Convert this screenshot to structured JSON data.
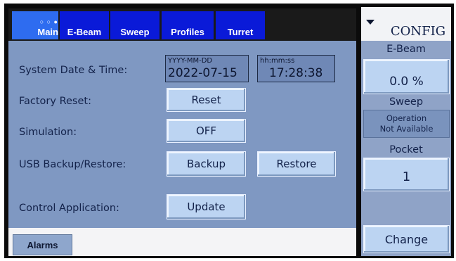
{
  "tabs": [
    {
      "label": "Main",
      "active": true,
      "dots": "○ ○ ●"
    },
    {
      "label": "E-Beam"
    },
    {
      "label": "Sweep"
    },
    {
      "label": "Profiles"
    },
    {
      "label": "Turret"
    }
  ],
  "rows": {
    "datetime_label": "System Date & Time:",
    "date_placeholder": "YYYY-MM-DD",
    "date_value": "2022-07-15",
    "time_placeholder": "hh:mm:ss",
    "time_value": "17:28:38",
    "factory_reset_label": "Factory Reset:",
    "reset_button": "Reset",
    "simulation_label": "Simulation:",
    "simulation_button": "OFF",
    "usb_label": "USB Backup/Restore:",
    "backup_button": "Backup",
    "restore_button": "Restore",
    "control_app_label": "Control Application:",
    "update_button": "Update"
  },
  "bottom": {
    "alarms_button": "Alarms"
  },
  "right": {
    "config_label": "CONFIG",
    "ebeam_label": "E-Beam",
    "ebeam_value": "0.0 %",
    "sweep_label": "Sweep",
    "sweep_status_line1": "Operation",
    "sweep_status_line2": "Not Available",
    "pocket_label": "Pocket",
    "pocket_value": "1",
    "change_button": "Change"
  },
  "colors": {
    "tab_blue": "#0a1ad8",
    "panel_bg": "#7f98c2",
    "button_bg": "#bcd4f2"
  },
  "icons": [
    "dropdown-triangle-icon"
  ]
}
